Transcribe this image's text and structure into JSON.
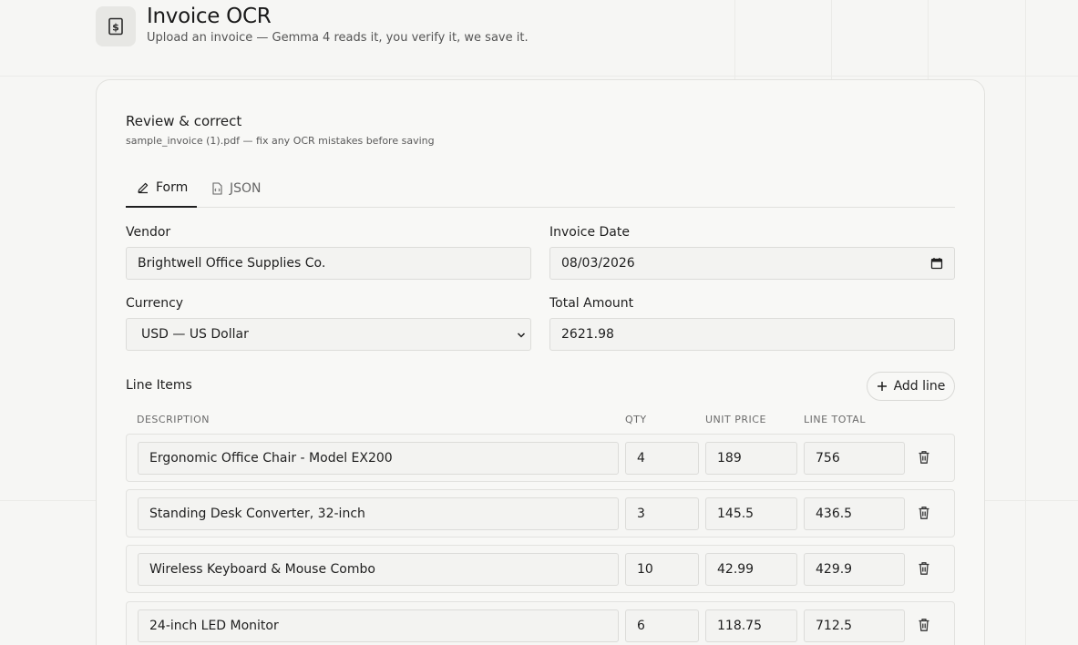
{
  "header": {
    "title": "Invoice OCR",
    "subtitle": "Upload an invoice — Gemma 4 reads it, you verify it, we save it."
  },
  "review": {
    "title": "Review & correct",
    "subtitle": "sample_invoice (1).pdf — fix any OCR mistakes before saving"
  },
  "tabs": [
    {
      "label": "Form",
      "icon": "pencil-icon",
      "active": true
    },
    {
      "label": "JSON",
      "icon": "file-code-icon",
      "active": false
    }
  ],
  "form": {
    "vendor_label": "Vendor",
    "vendor_value": "Brightwell Office Supplies Co.",
    "date_label": "Invoice Date",
    "date_value": "08/03/2026",
    "currency_label": "Currency",
    "currency_value": "USD — US Dollar",
    "total_label": "Total Amount",
    "total_value": "2621.98"
  },
  "line_items": {
    "title": "Line Items",
    "add_label": "Add line",
    "columns": [
      "DESCRIPTION",
      "QTY",
      "UNIT PRICE",
      "LINE TOTAL"
    ],
    "rows": [
      {
        "description": "Ergonomic Office Chair - Model EX200",
        "qty": "4",
        "unit_price": "189",
        "line_total": "756"
      },
      {
        "description": "Standing Desk Converter, 32-inch",
        "qty": "3",
        "unit_price": "145.5",
        "line_total": "436.5"
      },
      {
        "description": "Wireless Keyboard & Mouse Combo",
        "qty": "10",
        "unit_price": "42.99",
        "line_total": "429.9"
      },
      {
        "description": "24-inch LED Monitor",
        "qty": "6",
        "unit_price": "118.75",
        "line_total": "712.5"
      }
    ]
  }
}
